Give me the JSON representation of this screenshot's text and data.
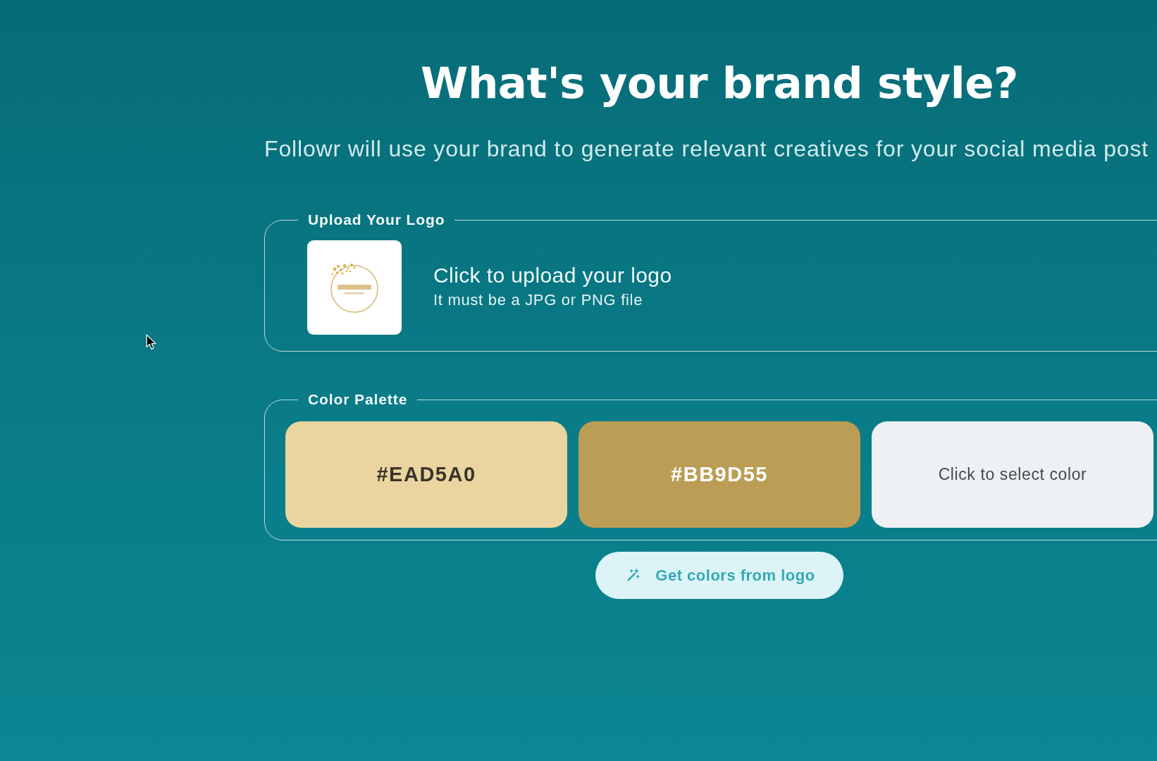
{
  "page": {
    "title": "What's your brand style?",
    "subtitle": "Followr will use your brand to generate relevant creatives for your social media post"
  },
  "logo_upload": {
    "legend": "Upload Your Logo",
    "prompt": "Click to upload your logo",
    "hint": "It must be a JPG or PNG file"
  },
  "color_palette": {
    "legend": "Color Palette",
    "swatches": [
      {
        "kind": "color",
        "label": "#EAD5A0",
        "color": "#ead5a0"
      },
      {
        "kind": "color",
        "label": "#BB9D55",
        "color": "#bb9d55"
      },
      {
        "kind": "empty",
        "label": "Click to select color"
      }
    ]
  },
  "extract_button": {
    "label": "Get colors from logo"
  }
}
